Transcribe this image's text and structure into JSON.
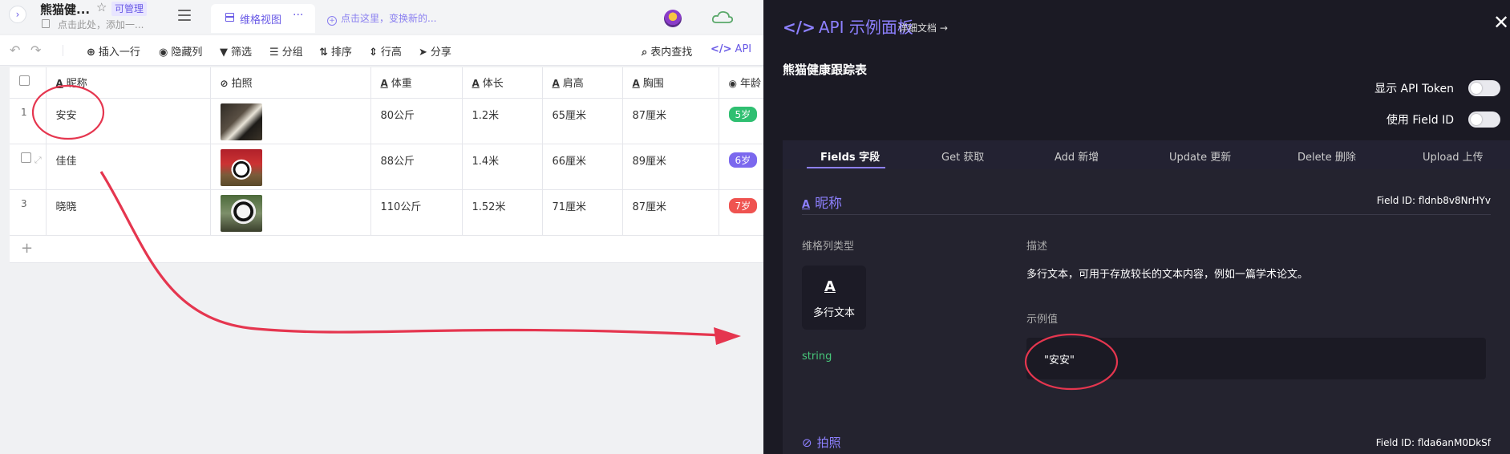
{
  "app": {
    "table_name": "熊猫健...",
    "manage_badge": "可管理",
    "description_placeholder": "点击此处，添加一...",
    "view_tab": "维格视图",
    "view_more": "···",
    "add_view": "点击这里，变换新的..."
  },
  "toolbar": {
    "insert_row": "插入一行",
    "hide_cols": "隐藏列",
    "filter": "筛选",
    "group": "分组",
    "sort": "排序",
    "row_height": "行高",
    "share": "分享",
    "find": "表内查找",
    "api": "API"
  },
  "grid": {
    "columns": [
      "昵称",
      "拍照",
      "体重",
      "体长",
      "肩高",
      "胸围",
      "年龄"
    ],
    "rows": [
      {
        "index": "1",
        "name": "安安",
        "weight": "80公斤",
        "length": "1.2米",
        "shoulder": "65厘米",
        "chest": "87厘米",
        "age": "5岁",
        "age_color": "#2fbf71"
      },
      {
        "index": "",
        "name": "佳佳",
        "weight": "88公斤",
        "length": "1.4米",
        "shoulder": "66厘米",
        "chest": "89厘米",
        "age": "6岁",
        "age_color": "#7b68ee"
      },
      {
        "index": "3",
        "name": "晓晓",
        "weight": "110公斤",
        "length": "1.52米",
        "shoulder": "71厘米",
        "chest": "87厘米",
        "age": "7岁",
        "age_color": "#ef5350"
      }
    ],
    "add_row": "+"
  },
  "api_panel": {
    "title": "API 示例面板",
    "doc_link": "详细文档 →",
    "table_title": "熊猫健康跟踪表",
    "show_token": "显示 API Token",
    "use_field_id": "使用 Field ID",
    "tabs": [
      "Fields 字段",
      "Get 获取",
      "Add 新增",
      "Update 更新",
      "Delete 删除",
      "Upload 上传"
    ],
    "field1": {
      "name": "昵称",
      "field_id": "Field ID: fldnb8v8NrHYv",
      "type_label": "维格列类型",
      "type_name": "多行文本",
      "desc_label": "描述",
      "desc": "多行文本，可用于存放较长的文本内容，例如一篇学术论文。",
      "example_label": "示例值",
      "example_value": "\"安安\"",
      "data_type": "string"
    },
    "field2": {
      "name": "拍照",
      "field_id": "Field ID: flda6anM0DkSf"
    }
  },
  "colors": {
    "accent": "#8d80ff",
    "panel_bg": "#1b1a24",
    "annotation": "#e5364f"
  }
}
